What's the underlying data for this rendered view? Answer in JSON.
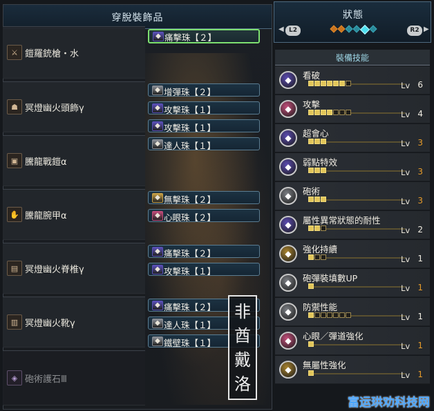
{
  "left_panel": {
    "title": "穿脫裝飾品",
    "equipment": [
      {
        "name": "鎧羅銃槍・水",
        "icon": "weapon-gunlance-icon",
        "glyph": "⚔"
      },
      {
        "name": "冥燈幽火頭飾γ",
        "icon": "helm-icon",
        "glyph": "☗"
      },
      {
        "name": "騰龍戰鎧α",
        "icon": "chest-armor-icon",
        "glyph": "▣"
      },
      {
        "name": "騰龍腕甲α",
        "icon": "arm-armor-icon",
        "glyph": "✋"
      },
      {
        "name": "冥燈幽火脊椎γ",
        "icon": "waist-armor-icon",
        "glyph": "▤"
      },
      {
        "name": "冥燈幽火靴γ",
        "icon": "leg-armor-icon",
        "glyph": "▥"
      },
      {
        "name": "砲術護石Ⅲ",
        "icon": "charm-icon",
        "glyph": "◈"
      }
    ],
    "jewels": [
      {
        "name": "痛擊珠【２】",
        "color": "#5a4fb8",
        "selected": true
      },
      {
        "name": "增彈珠【２】",
        "color": "#8a8f96",
        "selected": false
      },
      {
        "name": "攻擊珠【１】",
        "color": "#5a4fb8",
        "selected": false
      },
      {
        "name": "攻擊珠【１】",
        "color": "#5a4fb8",
        "selected": false
      },
      {
        "name": "達人珠【１】",
        "color": "#8a8f96",
        "selected": false
      },
      {
        "name": "無擊珠【２】",
        "color": "#c8a044",
        "selected": false
      },
      {
        "name": "心眼珠【２】",
        "color": "#c04a78",
        "selected": false
      },
      {
        "name": "痛擊珠【２】",
        "color": "#5a4fb8",
        "selected": false
      },
      {
        "name": "攻擊珠【１】",
        "color": "#5a4fb8",
        "selected": false
      },
      {
        "name": "痛擊珠【２】",
        "color": "#5a4fb8",
        "selected": false
      },
      {
        "name": "達人珠【１】",
        "color": "#8a8f96",
        "selected": false
      },
      {
        "name": "鐵壁珠【１】",
        "color": "#8a8f96",
        "selected": false
      }
    ]
  },
  "right_panel": {
    "title": "狀態",
    "l2": "L2",
    "r2": "R2",
    "sub_title": "裝備技能",
    "level_label": "Lv",
    "skills": [
      {
        "name": "看破",
        "level": "6",
        "max": 7,
        "badge_color": "#5b4bb0",
        "level_color": "white"
      },
      {
        "name": "攻擊",
        "level": "4",
        "max": 7,
        "badge_color": "#c24e7a",
        "level_color": "white"
      },
      {
        "name": "超會心",
        "level": "3",
        "max": 3,
        "badge_color": "#5b4bb0",
        "level_color": "orange"
      },
      {
        "name": "弱點特效",
        "level": "3",
        "max": 3,
        "badge_color": "#5b4bb0",
        "level_color": "orange"
      },
      {
        "name": "砲術",
        "level": "3",
        "max": 3,
        "badge_color": "#7a7d82",
        "level_color": "orange"
      },
      {
        "name": "屬性異常狀態的耐性",
        "level": "2",
        "max": 3,
        "badge_color": "#5b4bb0",
        "level_color": "white"
      },
      {
        "name": "強化持續",
        "level": "1",
        "max": 3,
        "badge_color": "#a8832e",
        "level_color": "white"
      },
      {
        "name": "砲彈裝填數UP",
        "level": "1",
        "max": 1,
        "badge_color": "#7a7d82",
        "level_color": "orange"
      },
      {
        "name": "防禦性能",
        "level": "1",
        "max": 7,
        "badge_color": "#7a7d82",
        "level_color": "white"
      },
      {
        "name": "心眼／彈道強化",
        "level": "1",
        "max": 1,
        "badge_color": "#c24e7a",
        "level_color": "orange"
      },
      {
        "name": "無屬性強化",
        "level": "1",
        "max": 1,
        "badge_color": "#a8832e",
        "level_color": "orange"
      }
    ]
  },
  "watermark_vertical": [
    "非",
    "酋",
    "戴",
    "洛"
  ],
  "watermark_bottom": "富运珙劝科技网"
}
